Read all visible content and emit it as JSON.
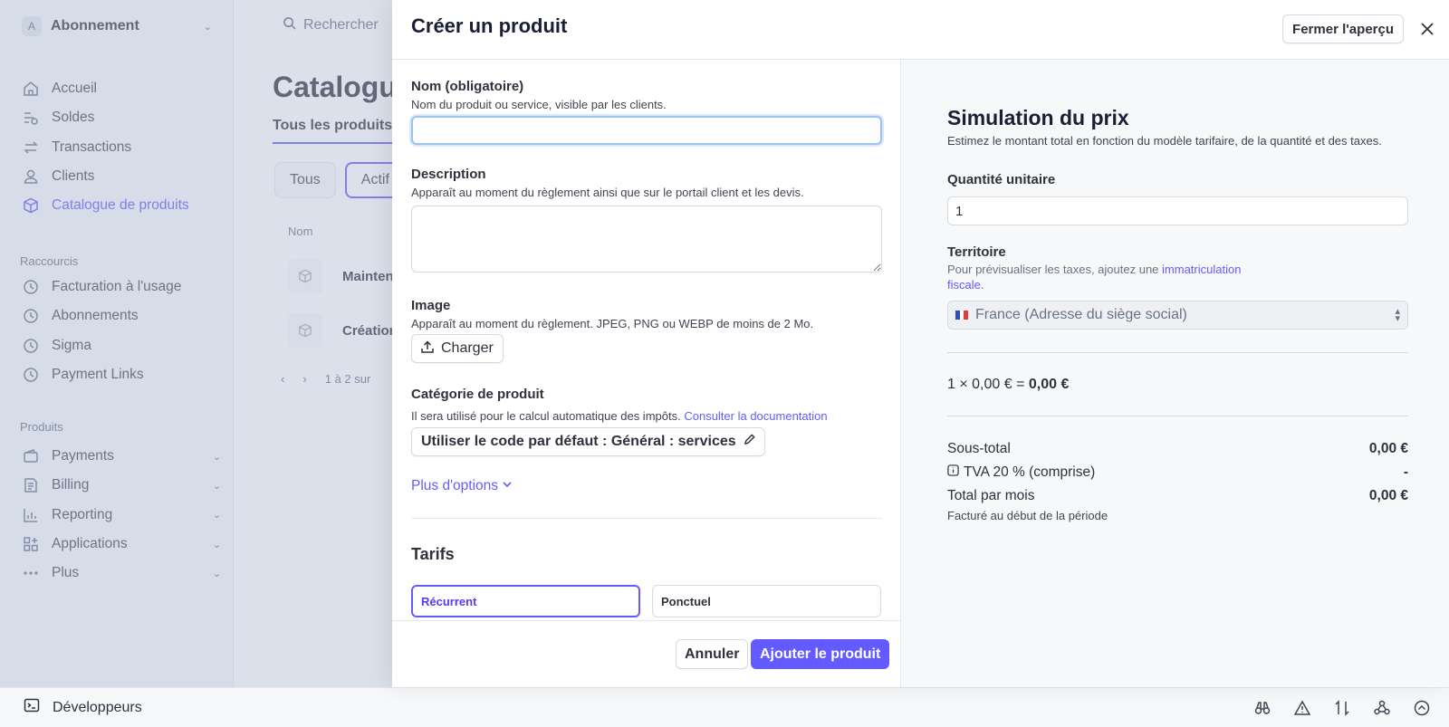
{
  "account": {
    "initial": "A",
    "name": "Abonnement"
  },
  "search": {
    "placeholder": "Rechercher"
  },
  "sidebar": {
    "items": [
      {
        "label": "Accueil",
        "icon": "home-icon"
      },
      {
        "label": "Soldes",
        "icon": "balance-icon"
      },
      {
        "label": "Transactions",
        "icon": "transactions-icon"
      },
      {
        "label": "Clients",
        "icon": "user-icon"
      },
      {
        "label": "Catalogue de produits",
        "icon": "cube-icon",
        "active": true
      }
    ],
    "shortcuts_title": "Raccourcis",
    "shortcuts": [
      {
        "label": "Facturation à l'usage",
        "icon": "clock-icon"
      },
      {
        "label": "Abonnements",
        "icon": "clock-icon"
      },
      {
        "label": "Sigma",
        "icon": "clock-icon"
      },
      {
        "label": "Payment Links",
        "icon": "clock-icon"
      }
    ],
    "products_title": "Produits",
    "products": [
      {
        "label": "Payments",
        "icon": "wallet-icon"
      },
      {
        "label": "Billing",
        "icon": "invoice-icon"
      },
      {
        "label": "Reporting",
        "icon": "chart-icon"
      },
      {
        "label": "Applications",
        "icon": "apps-icon"
      },
      {
        "label": "Plus",
        "icon": "more-icon"
      }
    ]
  },
  "background": {
    "title": "Catalogue",
    "tab": "Tous les produits",
    "filters": [
      "Tous",
      "Actif"
    ],
    "column": "Nom",
    "rows": [
      "Maintena",
      "Création"
    ],
    "pager": "1 à 2 sur"
  },
  "devbar": {
    "label": "Développeurs"
  },
  "modal": {
    "title": "Créer un produit",
    "close_preview": "Fermer l'aperçu",
    "name": {
      "label": "Nom (obligatoire)",
      "help": "Nom du produit ou service, visible par les clients.",
      "value": ""
    },
    "description": {
      "label": "Description",
      "help": "Apparaît au moment du règlement ainsi que sur le portail client et les devis."
    },
    "image": {
      "label": "Image",
      "help": "Apparaît au moment du règlement. JPEG, PNG ou WEBP de moins de 2 Mo.",
      "button": "Charger"
    },
    "category": {
      "label": "Catégorie de produit",
      "help": "Il sera utilisé pour le calcul automatique des impôts.",
      "link": "Consulter la documentation",
      "button": "Utiliser le code par défaut : Général : services"
    },
    "more_options": "Plus d'options",
    "pricing": {
      "title": "Tarifs",
      "options": [
        "Récurrent",
        "Ponctuel"
      ],
      "selected": "Récurrent"
    },
    "cancel": "Annuler",
    "submit": "Ajouter le produit"
  },
  "preview": {
    "title": "Simulation du prix",
    "subtitle": "Estimez le montant total en fonction du modèle tarifaire, de la quantité et des taxes.",
    "quantity_label": "Quantité unitaire",
    "quantity_value": "1",
    "territory_label": "Territoire",
    "territory_help": "Pour prévisualiser les taxes, ajoutez une",
    "territory_link": "immatriculation fiscale",
    "territory_value": "France (Adresse du siège social)",
    "formula_prefix": "1 × 0,00 € =",
    "formula_total": "0,00 €",
    "subtotal_label": "Sous-total",
    "subtotal_value": "0,00 €",
    "vat_label": "TVA 20 % (comprise)",
    "vat_value": "-",
    "total_label": "Total par mois",
    "total_value": "0,00 €",
    "billed_note": "Facturé au début de la période"
  },
  "colors": {
    "accent": "#635bff",
    "overlay": "#aab6d0"
  }
}
